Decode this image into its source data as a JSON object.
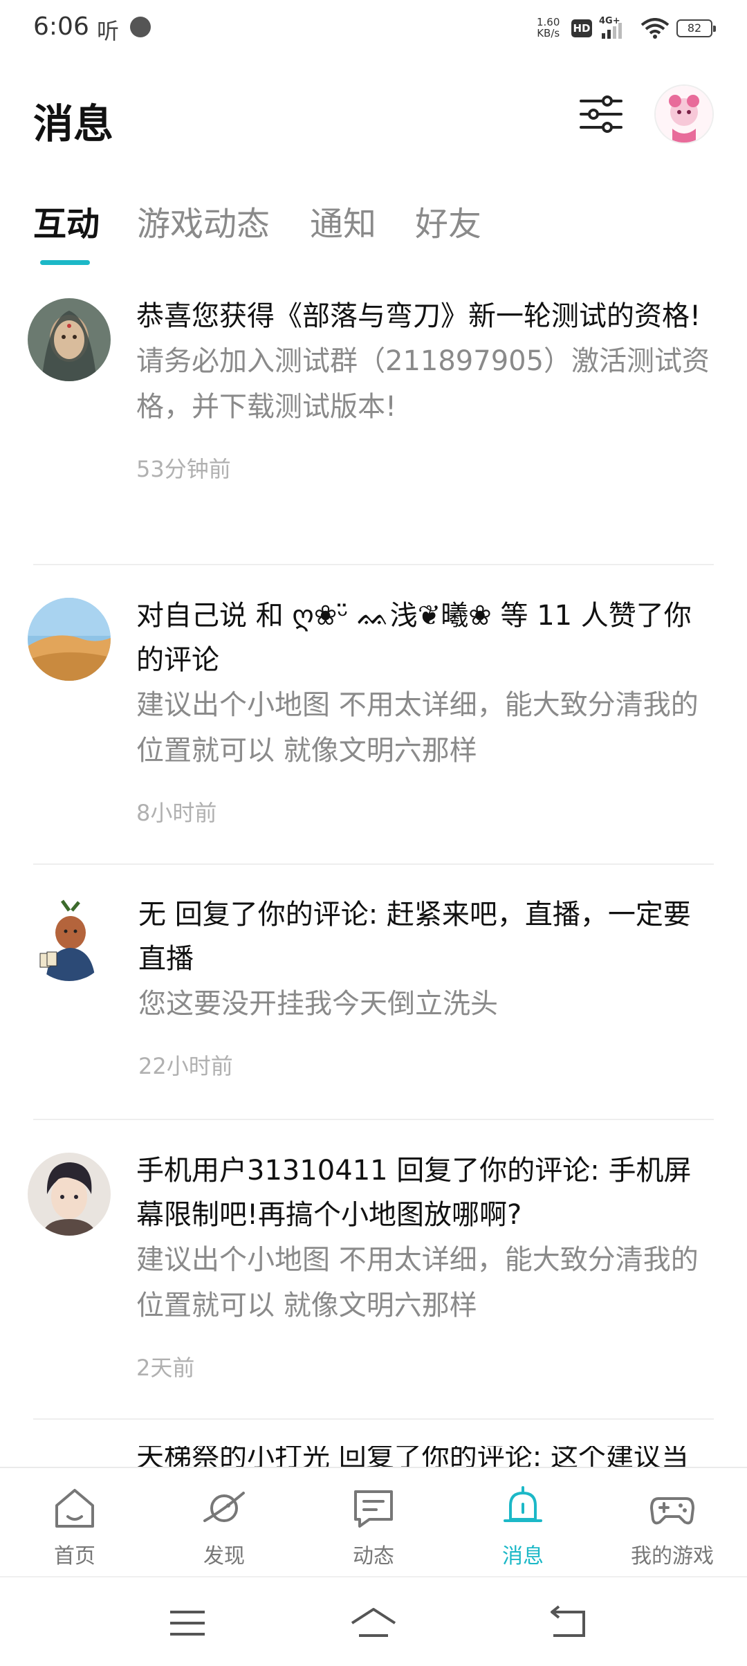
{
  "status_bar": {
    "time": "6:06",
    "ting_label": "听",
    "net_speed_value": "1.60",
    "net_speed_unit": "KB/s",
    "hd_label": "HD",
    "network_type": "4G+",
    "battery": "82"
  },
  "header": {
    "title": "消息"
  },
  "tabs": [
    {
      "label": "互动",
      "active": true
    },
    {
      "label": "游戏动态",
      "active": false
    },
    {
      "label": "通知",
      "active": false
    },
    {
      "label": "好友",
      "active": false
    }
  ],
  "messages": [
    {
      "title": "恭喜您获得《部落与弯刀》新一轮测试的资格!",
      "body": "请务必加入测试群（211897905）激活测试资格，并下载测试版本!",
      "time": "53分钟前"
    },
    {
      "title": "对自己说 和 ღ❀ᵕ̈ ᨐ浅❦曦❀ 等 11 人赞了你的评论",
      "body": "建议出个小地图 不用太详细，能大致分清我的位置就可以 就像文明六那样",
      "time": "8小时前"
    },
    {
      "title": "无 回复了你的评论: 赶紧来吧，直播，一定要直播",
      "body": "您这要没开挂我今天倒立洗头",
      "time": "22小时前"
    },
    {
      "title": "手机用户31310411 回复了你的评论: 手机屏幕限制吧!再搞个小地图放哪啊?",
      "body": "建议出个小地图 不用太详细，能大致分清我的位置就可以 就像文明六那样",
      "time": "2天前"
    },
    {
      "title": "天梯祭的小打光 回复了你的评论: 这个建议当",
      "body": "",
      "time": ""
    }
  ],
  "bottom_nav": [
    {
      "label": "首页",
      "icon": "home-icon",
      "active": false
    },
    {
      "label": "发现",
      "icon": "planet-icon",
      "active": false
    },
    {
      "label": "动态",
      "icon": "message-card-icon",
      "active": false
    },
    {
      "label": "消息",
      "icon": "bell-icon",
      "active": true
    },
    {
      "label": "我的游戏",
      "icon": "gamepad-icon",
      "active": false
    }
  ],
  "colors": {
    "accent": "#1cb8c7",
    "secondary_text": "#8a8a8a",
    "time_text": "#b0b0b0"
  }
}
